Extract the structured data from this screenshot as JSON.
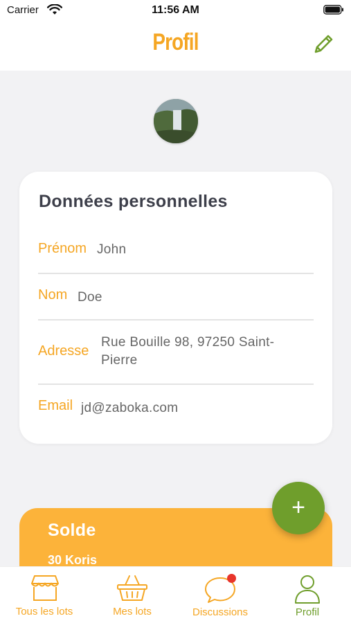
{
  "status_bar": {
    "carrier": "Carrier",
    "time": "11:56 AM"
  },
  "header": {
    "title": "Profil"
  },
  "personal": {
    "title": "Données personnelles",
    "fields": [
      {
        "label": "Prénom",
        "value": "John"
      },
      {
        "label": "Nom",
        "value": "Doe"
      },
      {
        "label": "Adresse",
        "value": "Rue Bouille 98, 97250 Saint-Pierre"
      },
      {
        "label": "Email",
        "value": "jd@zaboka.com"
      }
    ]
  },
  "balance": {
    "title": "Solde",
    "amount": "30 Koris"
  },
  "fab": {
    "label": "+"
  },
  "tabs": [
    {
      "label": "Tous les lots",
      "icon": "store-icon"
    },
    {
      "label": "Mes lots",
      "icon": "basket-icon"
    },
    {
      "label": "Discussions",
      "icon": "chat-icon"
    },
    {
      "label": "Profil",
      "icon": "user-icon"
    }
  ],
  "colors": {
    "accent": "#f5a623",
    "green": "#6f9e2c",
    "balance": "#fcb33a",
    "badge": "#e8352b"
  }
}
